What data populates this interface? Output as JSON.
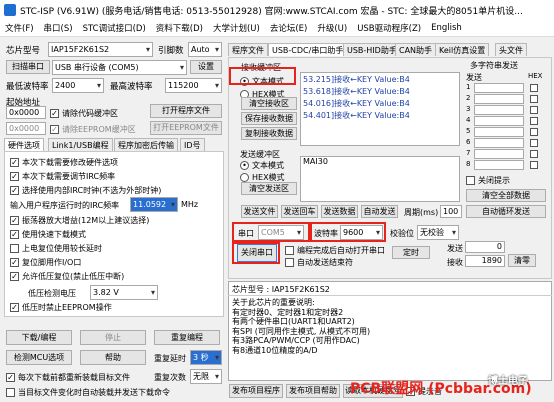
{
  "title": "STC-ISP (V6.91W) (服务电话/销售电话: 0513-55012928) 官网:www.STCAI.com  宏晶 - STC: 全球最大的8051单片机设...",
  "menu": [
    "文件(F)",
    "串口(S)",
    "STC调试接口(D)",
    "资料下载(D)",
    "大学计划(U)",
    "去论坛(E)",
    "升级(U)",
    "USB驱动程序(Z)",
    "English"
  ],
  "left": {
    "chip_label": "芯片型号",
    "chip_value": "IAP15F2K61S2",
    "pin_label": "引脚数",
    "pin_value": "Auto",
    "scan_btn": "扫描串口",
    "port_value": "USB 串行设备 (COM5)",
    "settings_btn": "设置",
    "minbaud_label": "最低波特率",
    "minbaud": "2400",
    "maxbaud_label": "最高波特率",
    "maxbaud": "115200",
    "start_label": "起始地址",
    "addr1": "0x0000",
    "clear_code": "请除代码缓冲区",
    "open_prog": "打开程序文件",
    "addr2": "0x0000",
    "clear_eeprom": "请除EEPROM缓冲区",
    "open_eeprom": "打开EEPROM文件",
    "hwtabs": [
      "硬件选项",
      "Link1/USB编程",
      "程序加密后传输",
      "ID号"
    ],
    "opts": [
      "本次下载需要修改硬件选项",
      "本次下载需要调节IRC频率",
      "选择使用内部IRC时钟(不选为外部时钟)"
    ],
    "irc_label": "输入用户程序运行时的IRC频率",
    "irc_value": "11.0592",
    "irc_unit": "MHz",
    "opts2": [
      "振荡器放大增益(12M以上建议选择)",
      "使用快速下载模式",
      "上电复位使用较长延时",
      "复位脚用作I/O口",
      "允许低压复位(禁止低压中断)"
    ],
    "lv_label": "低压检测电压",
    "lv_value": "3.82 V",
    "opt_last": "低压时禁止EEPROM操作",
    "download_btn": "下载/编程",
    "stop_btn": "停止",
    "reprog_btn": "重复编程",
    "detect_btn": "检测MCU选项",
    "help_btn": "帮助",
    "delay_label": "重复延时",
    "delay_value": "3 秒",
    "reload": "每次下载前都重新装载目标文件",
    "count_label": "重复次数",
    "count_value": "无限",
    "autosend": "当目标文件变化时自动装载并发送下载命令"
  },
  "right": {
    "tabs": [
      "程序文件",
      "USB-CDC/串口助手",
      "USB-HID助手",
      "CAN助手",
      "Keil仿真设置",
      "头文件"
    ],
    "recv_label": "接收缓冲区",
    "recv_text": "文本模式",
    "recv_hex": "HEX模式",
    "clear_recv": "清空接收区",
    "save_recv": "保存接收数据",
    "copy_recv": "复制接收数据",
    "log": [
      "53.215]接收←KEY Value:B4",
      "53.618]接收←KEY Value:B4",
      "54.016]接收←KEY Value:B4",
      "54.401]接收←KEY Value:B4"
    ],
    "send_label": "发送缓冲区",
    "send_text": "文本模式",
    "send_hex": "HEX模式",
    "clear_send": "清空发送区",
    "send_value": "MAI30",
    "send_file": "发送文件",
    "send_enter": "发送回车",
    "send_data": "发送数据",
    "auto_send": "自动发送",
    "period_label": "周期(ms)",
    "period_value": "100",
    "port_label": "串口",
    "port_value": "COM5",
    "baud_label": "波特率",
    "baud_value": "9600",
    "parity_label": "校验位",
    "parity_value": "无校验",
    "stop_label": "停止位",
    "stop_value": "1位",
    "close_port": "关闭串口",
    "program_done": "编程完成后自动打开串口",
    "auto_end": "自动发送结束符",
    "timed": "定时",
    "send_count_label": "发送",
    "send_count": "0",
    "recv_count_label": "接收",
    "recv_count": "1890",
    "clear_count": "清零",
    "multi_title": "多字符串发送",
    "multi_send": "发送",
    "multi_hex": "HEX",
    "rows": [
      "1",
      "2",
      "3",
      "4",
      "5",
      "6",
      "7",
      "8"
    ],
    "close_hint": "关闭提示",
    "clear_all": "清空全部数据",
    "auto_cycle": "自动循环发送",
    "chip2": "芯片型号 : IAP15F2K61S2",
    "info": [
      "关于此芯片的重要说明:",
      "  有定时器0、定时器1和定时器2",
      "  有两个硬件串口(UART1和UART2)",
      "  有SPI (可同用作主模式, 从模式不可用)",
      "  有3路PCA/PWM/CCP (可用作DAC)",
      "  有8通道10位精度的A/D"
    ],
    "pub_prog": "发布项目程序",
    "pub_help": "发布项目帮助",
    "read_id": "读取本机硬盘号",
    "hint_sound": "提示音"
  },
  "watermark": {
    "brand": "PCB联盟网 (Pcbbar.com)",
    "channel": "博士电子"
  }
}
